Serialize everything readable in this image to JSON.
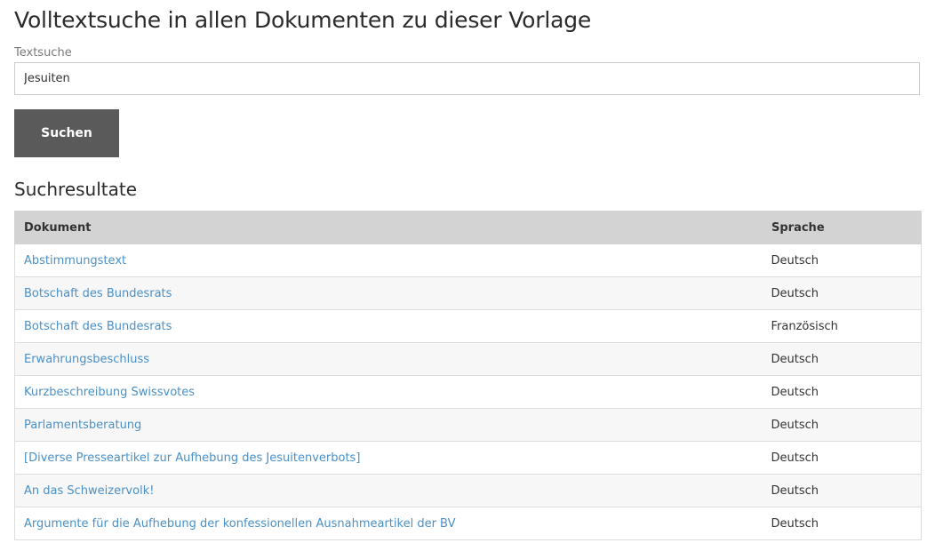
{
  "header": {
    "title": "Volltextsuche in allen Dokumenten zu dieser Vorlage"
  },
  "search": {
    "label": "Textsuche",
    "value": "Jesuiten",
    "button_label": "Suchen"
  },
  "results": {
    "heading": "Suchresultate",
    "columns": [
      "Dokument",
      "Sprache"
    ],
    "rows": [
      {
        "document": "Abstimmungstext",
        "language": "Deutsch"
      },
      {
        "document": "Botschaft des Bundesrats",
        "language": "Deutsch"
      },
      {
        "document": "Botschaft des Bundesrats",
        "language": "Französisch"
      },
      {
        "document": "Erwahrungsbeschluss",
        "language": "Deutsch"
      },
      {
        "document": "Kurzbeschreibung Swissvotes",
        "language": "Deutsch"
      },
      {
        "document": "Parlamentsberatung",
        "language": "Deutsch"
      },
      {
        "document": "[Diverse Presseartikel zur Aufhebung des Jesuitenverbots]",
        "language": "Deutsch"
      },
      {
        "document": "An das Schweizervolk!",
        "language": "Deutsch"
      },
      {
        "document": "Argumente für die Aufhebung der konfessionellen Ausnahmeartikel der BV",
        "language": "Deutsch"
      }
    ]
  },
  "colors": {
    "link": "#4a90c8",
    "button": "#5a5a5a",
    "table_header": "#d3d3d3"
  }
}
